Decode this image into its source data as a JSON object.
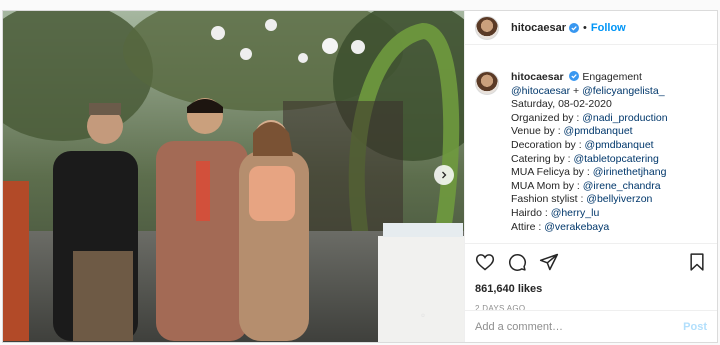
{
  "post": {
    "username": "hitocaesar",
    "follow_label": "Follow",
    "separator": "•",
    "caption": {
      "title": "Engagement",
      "lines": [
        {
          "prefix": "",
          "tag": "@hitocaesar",
          "joiner": " + ",
          "tag2": "@felicyangelista_"
        },
        {
          "prefix": "Saturday, 08-02-2020",
          "tag": ""
        },
        {
          "prefix": "Organized by : ",
          "tag": "@nadi_production"
        },
        {
          "prefix": "Venue by : ",
          "tag": "@pmdbanquet"
        },
        {
          "prefix": "Decoration by : ",
          "tag": "@pmdbanquet"
        },
        {
          "prefix": "Catering by : ",
          "tag": "@tabletopcatering"
        },
        {
          "prefix": "MUA Felicya by : ",
          "tag": "@irinethetjhang"
        },
        {
          "prefix": "MUA Mom by : ",
          "tag": "@irene_chandra"
        },
        {
          "prefix": "Fashion stylist : ",
          "tag": "@bellyiverzon"
        },
        {
          "prefix": "Hairdo : ",
          "tag": "@herry_lu"
        },
        {
          "prefix": "Attire : ",
          "tag": "@verakebaya"
        }
      ]
    },
    "likes": "861,640 likes",
    "time_ago": "2 DAYS AGO",
    "comment_placeholder": "Add a comment…",
    "post_label": "Post"
  },
  "icons": {
    "verified": "verified-badge-icon",
    "like": "heart-icon",
    "comment": "comment-icon",
    "share": "share-icon",
    "save": "bookmark-icon",
    "next": "chevron-right-icon"
  },
  "colors": {
    "link": "#0095f6",
    "tag": "#00376b",
    "muted": "#8e8e8e",
    "border": "#dbdbdb"
  }
}
